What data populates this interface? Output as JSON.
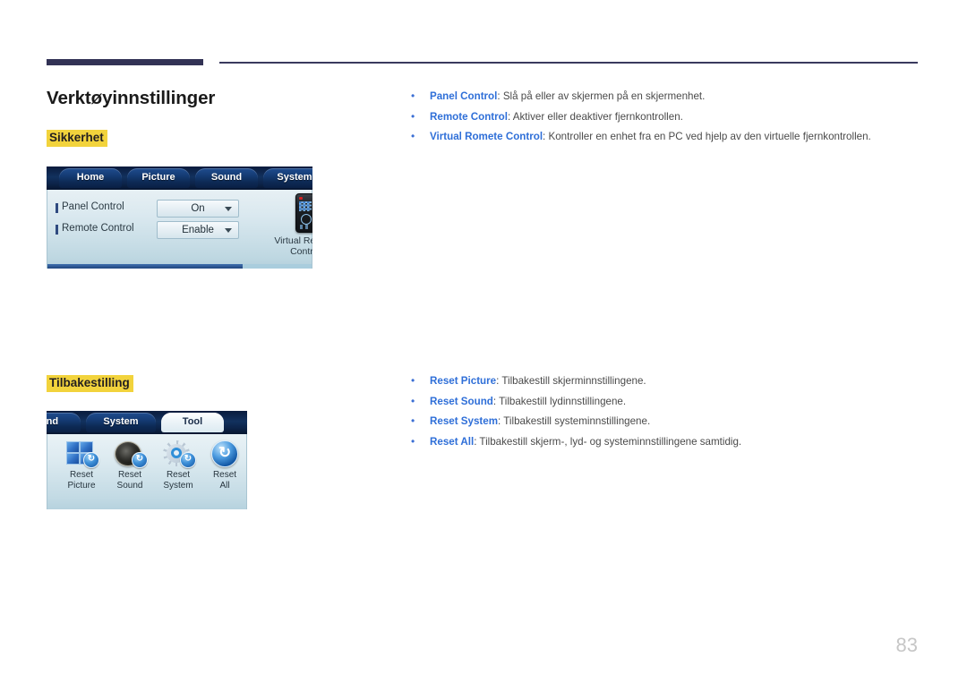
{
  "page": {
    "title": "Verktøyinnstillinger",
    "number": "83"
  },
  "sections": [
    {
      "heading": "Sikkerhet",
      "bullets": [
        {
          "term": "Panel Control",
          "sep": ": ",
          "desc": "Slå på eller av skjermen på en skjermenhet."
        },
        {
          "term": "Remote Control",
          "sep": ": ",
          "desc": "Aktiver eller deaktiver fjernkontrollen."
        },
        {
          "term": "Virtual Romete Control",
          "sep": ": ",
          "desc": "Kontroller en enhet fra en PC ved hjelp av den virtuelle fjernkontrollen."
        }
      ]
    },
    {
      "heading": "Tilbakestilling",
      "bullets": [
        {
          "term": "Reset Picture",
          "sep": ": ",
          "desc": "Tilbakestill skjerminnstillingene."
        },
        {
          "term": "Reset Sound",
          "sep": ": ",
          "desc": "Tilbakestill lydinnstillingene."
        },
        {
          "term": "Reset System",
          "sep": ": ",
          "desc": "Tilbakestill systeminnstillingene."
        },
        {
          "term": "Reset All",
          "sep": ": ",
          "desc": "Tilbakestill skjerm-, lyd- og systeminnstillingene samtidig."
        }
      ]
    }
  ],
  "osd_security": {
    "tabs": [
      {
        "label": "Home",
        "active": false
      },
      {
        "label": "Picture",
        "active": false
      },
      {
        "label": "Sound",
        "active": false
      },
      {
        "label": "System",
        "active": true
      }
    ],
    "rows": [
      {
        "label": "Panel Control",
        "value": "On"
      },
      {
        "label": "Remote Control",
        "value": "Enable"
      }
    ],
    "virtual_remote": {
      "line1": "Virtual Remote",
      "line2": "Control",
      "icon": "remote-control-icon"
    },
    "scroll_percent": 74
  },
  "osd_reset": {
    "tabs": [
      {
        "label": "und",
        "active": false
      },
      {
        "label": "System",
        "active": false
      },
      {
        "label": "Tool",
        "active": true
      }
    ],
    "items": [
      {
        "line1": "Reset",
        "line2": "Picture",
        "icon": "reset-picture-icon"
      },
      {
        "line1": "Reset",
        "line2": "Sound",
        "icon": "reset-sound-icon"
      },
      {
        "line1": "Reset",
        "line2": "System",
        "icon": "reset-system-icon"
      },
      {
        "line1": "Reset",
        "line2": "All",
        "icon": "reset-all-icon"
      }
    ]
  },
  "colors": {
    "rule": "#323255",
    "highlight": "#f2d33c",
    "link": "#2f6fd8",
    "body_text": "#4a4a4a",
    "page_number": "#c6c6c6"
  }
}
